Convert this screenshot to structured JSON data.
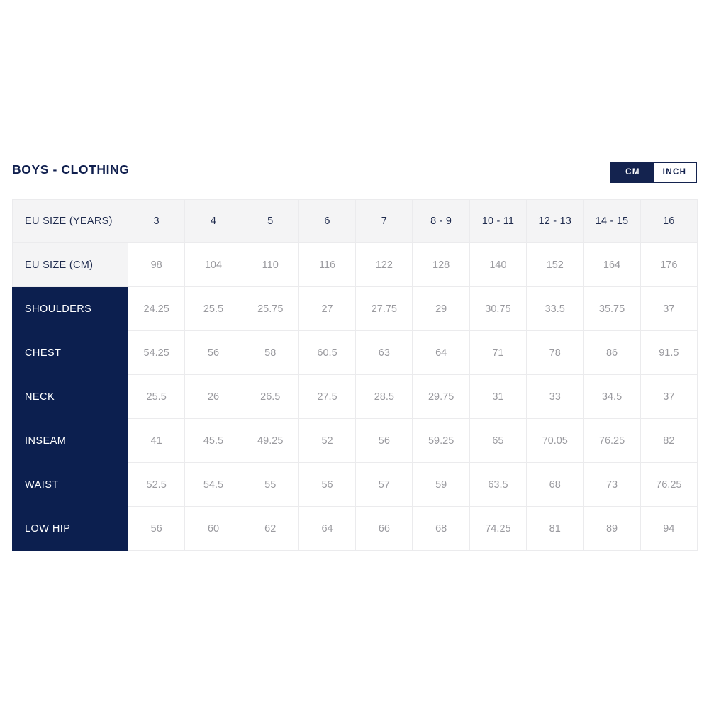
{
  "chart": {
    "title": "BOYS - CLOTHING",
    "unit_toggle": {
      "options": [
        {
          "label": "CM",
          "selected": true
        },
        {
          "label": "INCH",
          "selected": false
        }
      ]
    },
    "colors": {
      "navy": "#0c1f4f",
      "toggle_navy": "#14234f",
      "header_gray": "#f4f4f5",
      "value_gray": "#9a9a9f",
      "border": "#ebebed"
    }
  },
  "chart_data": {
    "type": "table",
    "title": "BOYS - CLOTHING",
    "unit": "CM",
    "row_header_labels": [
      "EU SIZE (YEARS)",
      "EU SIZE (CM)"
    ],
    "categories": [
      "3",
      "4",
      "5",
      "6",
      "7",
      "8 - 9",
      "10 - 11",
      "12 - 13",
      "14 - 15",
      "16"
    ],
    "eu_size_cm": [
      "98",
      "104",
      "110",
      "116",
      "122",
      "128",
      "140",
      "152",
      "164",
      "176"
    ],
    "series": [
      {
        "name": "SHOULDERS",
        "values": [
          "24.25",
          "25.5",
          "25.75",
          "27",
          "27.75",
          "29",
          "30.75",
          "33.5",
          "35.75",
          "37"
        ]
      },
      {
        "name": "CHEST",
        "values": [
          "54.25",
          "56",
          "58",
          "60.5",
          "63",
          "64",
          "71",
          "78",
          "86",
          "91.5"
        ]
      },
      {
        "name": "NECK",
        "values": [
          "25.5",
          "26",
          "26.5",
          "27.5",
          "28.5",
          "29.75",
          "31",
          "33",
          "34.5",
          "37"
        ]
      },
      {
        "name": "INSEAM",
        "values": [
          "41",
          "45.5",
          "49.25",
          "52",
          "56",
          "59.25",
          "65",
          "70.05",
          "76.25",
          "82"
        ]
      },
      {
        "name": "WAIST",
        "values": [
          "52.5",
          "54.5",
          "55",
          "56",
          "57",
          "59",
          "63.5",
          "68",
          "73",
          "76.25"
        ]
      },
      {
        "name": "LOW HIP",
        "values": [
          "56",
          "60",
          "62",
          "64",
          "66",
          "68",
          "74.25",
          "81",
          "89",
          "94"
        ]
      }
    ]
  }
}
